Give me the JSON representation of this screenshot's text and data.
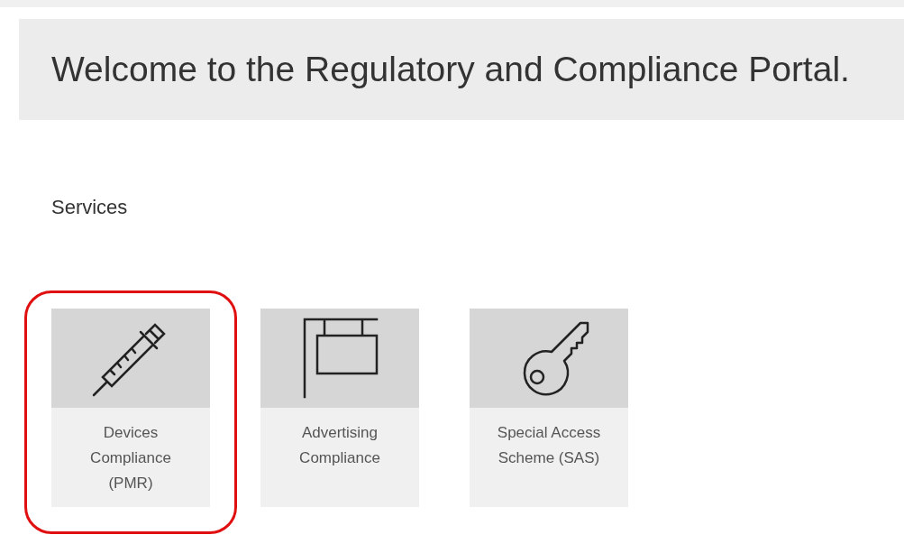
{
  "header": {
    "title": "Welcome to the Regulatory and Compliance Portal."
  },
  "services": {
    "heading": "Services",
    "tiles": [
      {
        "kind": "syringe",
        "label": "Devices Compliance (PMR)",
        "highlighted": true
      },
      {
        "kind": "sign",
        "label": "Advertising Compliance",
        "highlighted": false
      },
      {
        "kind": "key",
        "label": "Special Access Scheme (SAS)",
        "highlighted": false
      }
    ]
  }
}
